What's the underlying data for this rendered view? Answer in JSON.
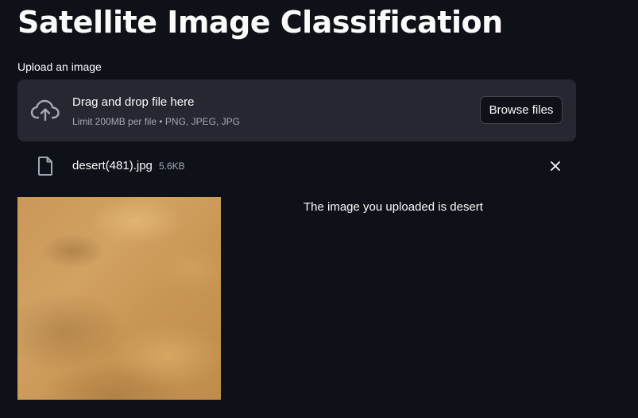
{
  "page": {
    "title": "Satellite Image Classification"
  },
  "uploader": {
    "label": "Upload an image",
    "drop_text": "Drag and drop file here",
    "limit_text": "Limit 200MB per file • PNG, JPEG, JPG",
    "browse_label": "Browse files",
    "icon": "cloud-upload-icon"
  },
  "uploaded_file": {
    "name": "desert(481).jpg",
    "size": "5.6KB",
    "icon": "file-icon",
    "remove_icon": "close-icon"
  },
  "result": {
    "message": "The image you uploaded is desert"
  },
  "colors": {
    "background": "#0e1117",
    "dropzone": "#262730",
    "text": "#fafafa",
    "muted_text": "#a3a8b8"
  }
}
